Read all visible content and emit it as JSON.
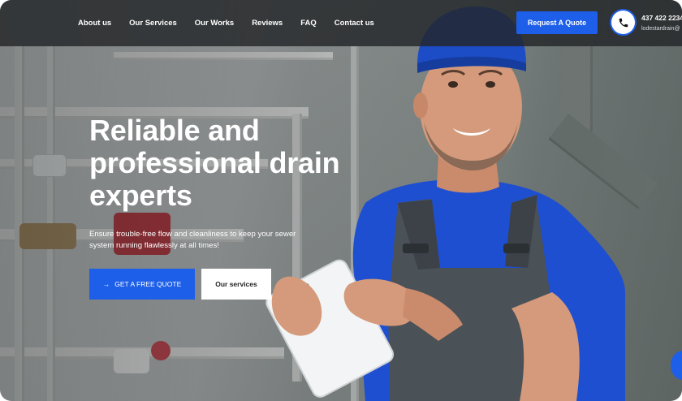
{
  "nav": {
    "items": [
      {
        "label": "About us"
      },
      {
        "label": "Our Services"
      },
      {
        "label": "Our Works"
      },
      {
        "label": "Reviews"
      },
      {
        "label": "FAQ"
      },
      {
        "label": "Contact us"
      }
    ]
  },
  "header": {
    "quote_button": "Request A Quote",
    "phone_icon": "phone-icon",
    "phone_number": "437 422 2234",
    "email": "lodestardrain@"
  },
  "hero": {
    "title": "Reliable and professional drain experts",
    "subtitle": "Ensure trouble-free flow and cleanliness to keep your sewer system running flawlessly at all times!",
    "primary_button": "GET A FREE QUOTE",
    "primary_icon": "arrow-right-icon",
    "secondary_button": "Our services"
  },
  "colors": {
    "accent": "#1d5fe8",
    "header_bg": "#232628"
  }
}
